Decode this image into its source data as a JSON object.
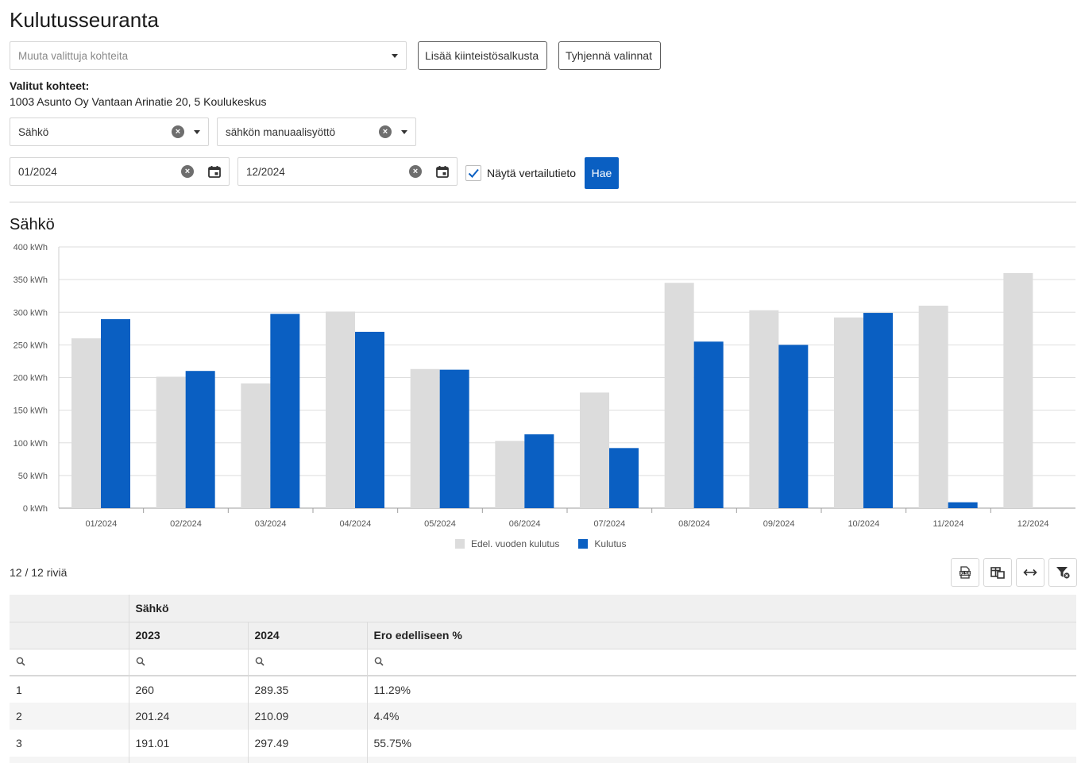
{
  "page": {
    "title": "Kulutusseuranta"
  },
  "target_select": {
    "placeholder": "Muuta valittuja kohteita"
  },
  "buttons": {
    "add_from_portfolio": "Lisää kiinteistösalkusta",
    "clear_selections": "Tyhjennä valinnat",
    "search": "Hae"
  },
  "selected": {
    "label": "Valitut kohteet:",
    "value": "1003 Asunto Oy Vantaan Arinatie 20, 5 Koulukeskus"
  },
  "filters": {
    "type": "Sähkö",
    "source": "sähkön manuaalisyöttö",
    "start": "01/2024",
    "end": "12/2024",
    "compare_label": "Näytä vertailutieto",
    "compare_checked": true
  },
  "chart_section": {
    "title": "Sähkö"
  },
  "chart_data": {
    "type": "bar",
    "categories": [
      "01/2024",
      "02/2024",
      "03/2024",
      "04/2024",
      "05/2024",
      "06/2024",
      "07/2024",
      "08/2024",
      "09/2024",
      "10/2024",
      "11/2024",
      "12/2024"
    ],
    "series": [
      {
        "name": "Edel. vuoden kulutus",
        "color": "#dcdcdc",
        "values": [
          260,
          201.24,
          191.01,
          301,
          213,
          103,
          177,
          345,
          303,
          292,
          310,
          360
        ]
      },
      {
        "name": "Kulutus",
        "color": "#0a5fc2",
        "values": [
          289.35,
          210.09,
          297.49,
          270,
          212,
          113,
          92,
          255,
          250,
          299,
          9,
          0
        ]
      }
    ],
    "yticks": [
      "0 kWh",
      "50 kWh",
      "100 kWh",
      "150 kWh",
      "200 kWh",
      "250 kWh",
      "300 kWh",
      "350 kWh",
      "400 kWh"
    ],
    "ylim": [
      0,
      400
    ],
    "grid": true,
    "legend_position": "bottom"
  },
  "grid": {
    "row_count": "12 / 12 riviä",
    "group_header": "Sähkö",
    "columns": [
      "2023",
      "2024",
      "Ero edelliseen %"
    ],
    "rows": [
      [
        "1",
        "260",
        "289.35",
        "11.29%"
      ],
      [
        "2",
        "201.24",
        "210.09",
        "4.4%"
      ],
      [
        "3",
        "191.01",
        "297.49",
        "55.75%"
      ]
    ]
  },
  "icons": {
    "export": "excel-export-icon",
    "columns": "column-chooser-icon",
    "fit": "fit-columns-icon",
    "filter": "clear-filter-icon"
  }
}
